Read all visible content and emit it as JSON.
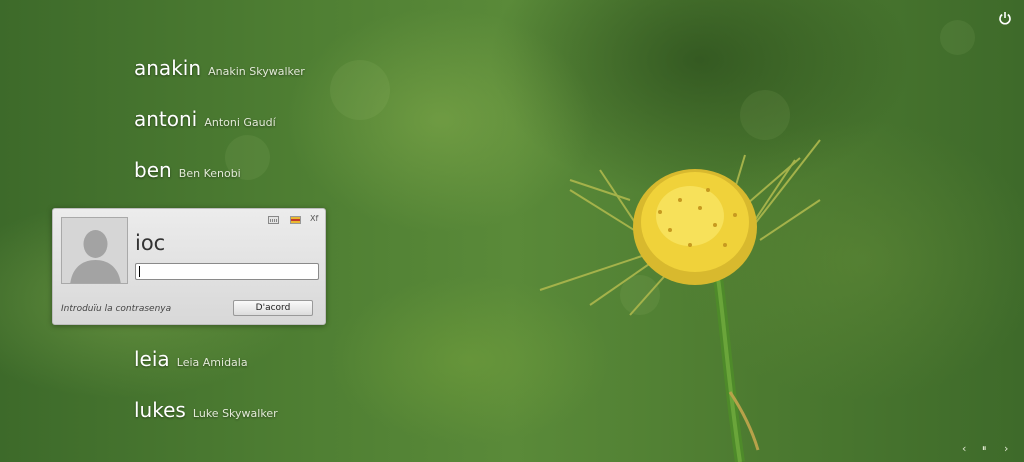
{
  "users": [
    {
      "username": "anakin",
      "realname": "Anakin Skywalker"
    },
    {
      "username": "antoni",
      "realname": "Antoni Gaudí"
    },
    {
      "username": "ben",
      "realname": "Ben Kenobi"
    },
    {
      "username": "leia",
      "realname": "Leia Amidala"
    },
    {
      "username": "lukes",
      "realname": "Luke Skywalker"
    }
  ],
  "login": {
    "username": "ioc",
    "password_value": "",
    "prompt": "Introduïu la contrasenya",
    "ok_label": "D'acord",
    "session_label": "Xf"
  },
  "icons": {
    "power": "power-icon",
    "keyboard": "keyboard-icon",
    "language": "language-flag-icon",
    "prev": "chevron-left-icon",
    "pause": "pause-icon",
    "next": "chevron-right-icon",
    "avatar": "user-silhouette-icon"
  },
  "colors": {
    "background": "#4f7f33",
    "panel": "#e2e2e2",
    "text_light": "#ffffff"
  },
  "nav": {
    "prev": "‹",
    "pause": "⏸",
    "next": "›"
  }
}
